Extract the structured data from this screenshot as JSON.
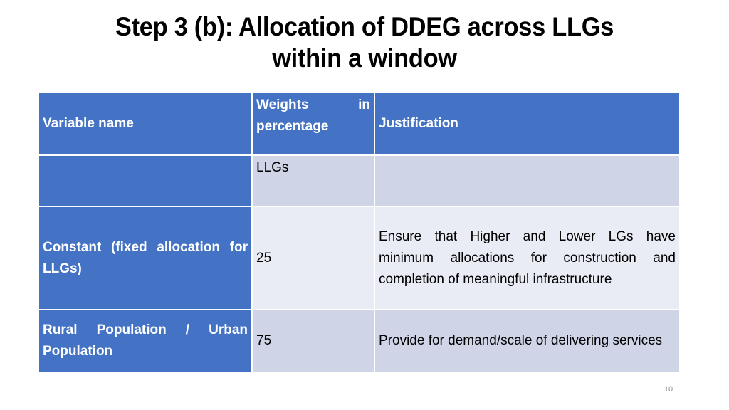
{
  "slide": {
    "title_line1": "Step 3 (b): Allocation of DDEG across LLGs",
    "title_line2": "within a window",
    "page_number": "10"
  },
  "table": {
    "headers": {
      "variable": "Variable name",
      "weights_word1": "Weights",
      "weights_word2": "in",
      "weights_line2": "percentage",
      "justification": "Justification"
    },
    "rows": [
      {
        "variable": "",
        "weight": "LLGs",
        "justification": ""
      },
      {
        "variable": "Constant (fixed allocation for LLGs)",
        "weight": "25",
        "justification": "Ensure that Higher and Lower LGs have minimum allocations for construction and completion of meaningful infrastructure"
      },
      {
        "variable": "Rural Population / Urban Population",
        "weight": "75",
        "justification": "Provide for demand/scale of delivering services"
      }
    ]
  },
  "colors": {
    "header_blue": "#4472c4",
    "band_dark": "#cfd5e7",
    "band_light": "#e9ebf5"
  }
}
